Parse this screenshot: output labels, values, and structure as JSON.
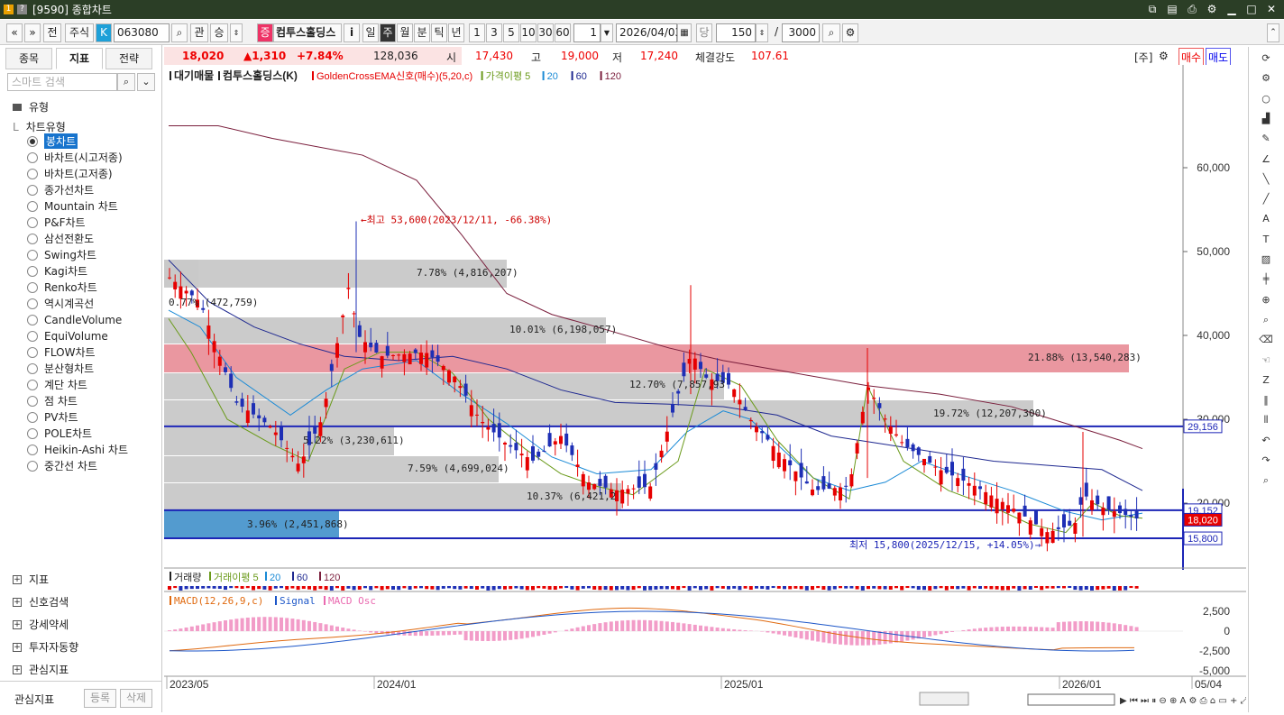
{
  "window": {
    "title": "[9590] 종합차트"
  },
  "toolbar": {
    "market": "주식",
    "code": "063080",
    "name": "컴투스홀딩스",
    "date": "2026/04/03",
    "count": "150",
    "total": "3000",
    "period_buttons": [
      "일",
      "주",
      "월",
      "분",
      "틱",
      "년"
    ],
    "minute_buttons": [
      "1",
      "3",
      "5",
      "10",
      "30",
      "60"
    ],
    "interval_value": "1"
  },
  "left": {
    "tabs": [
      "종목",
      "지표",
      "전략"
    ],
    "search_placeholder": "스마트 검색",
    "section_type": "유형",
    "chart_type_header": "차트유형",
    "chart_types": [
      "봉차트",
      "바차트(시고저종)",
      "바차트(고저종)",
      "종가선차트",
      "Mountain 차트",
      "P&F차트",
      "삼선전환도",
      "Swing차트",
      "Kagi차트",
      "Renko차트",
      "역시계곡선",
      "CandleVolume",
      "EquiVolume",
      "FLOW차트",
      "분산형차트",
      "계단 차트",
      "점 차트",
      "PV차트",
      "POLE차트",
      "Heikin-Ashi 차트",
      "중간선 차트"
    ],
    "bottom_sections": [
      "지표",
      "신호검색",
      "강세약세",
      "투자자동향",
      "관심지표"
    ],
    "footer_label": "관심지표",
    "footer_btn1": "등록",
    "footer_btn2": "삭제"
  },
  "ticker": {
    "price": "18,020",
    "change": "▲1,310",
    "rate": "+7.84%",
    "volume": "128,036",
    "open_label": "시",
    "open": "17,430",
    "high_label": "고",
    "high": "19,000",
    "low_label": "저",
    "low": "17,240",
    "strength_label": "체결강도",
    "strength": "107.61",
    "buy_label": "매수",
    "sell_label": "매도",
    "unit": "[주]"
  },
  "chart_data": {
    "type": "candlestick",
    "legend": [
      "대기매물",
      "컴투스홀딩스(K)",
      "GoldenCrossEMA신호(매수)(5,20,c)",
      "가격이평 5",
      "20",
      "60",
      "120"
    ],
    "y_ticks": [
      "60,000",
      "50,000",
      "40,000",
      "30,000",
      "20,000"
    ],
    "x_ticks": [
      "2023/05",
      "2024/01",
      "2025/01",
      "2026/01",
      "05/04"
    ],
    "price_tags": [
      "29,156",
      "19,152",
      "18,020",
      "15,800"
    ],
    "high_annotation": "최고 53,600(2023/12/11, -66.38%)",
    "low_annotation": "최저 15,800(2025/12/15, +14.05%)",
    "volume_profile": [
      {
        "label": "0.77% (472,759)",
        "value": 0.77
      },
      {
        "label": "7.78% (4,816,207)",
        "value": 7.78
      },
      {
        "label": "10.01% (6,198,057)",
        "value": 10.01
      },
      {
        "label": "21.88% (13,540,283)",
        "value": 21.88
      },
      {
        "label": "12.70% (7,857,93",
        "value": 12.7
      },
      {
        "label": "19.72% (12,207,300)",
        "value": 19.72
      },
      {
        "label": "5.22% (3,230,611)",
        "value": 5.22
      },
      {
        "label": "7.59% (4,699,024)",
        "value": 7.59
      },
      {
        "label": "10.37% (6,421,2",
        "value": 10.37
      },
      {
        "label": "3.96% (2,451,868)",
        "value": 3.96
      }
    ],
    "volume_legend": [
      "거래량",
      "거래이평 5",
      "20",
      "60",
      "120"
    ],
    "macd_legend": [
      "MACD(12,26,9,c)",
      "Signal",
      "MACD Osc"
    ],
    "macd_ticks": [
      "2,500",
      "0",
      "-2,500",
      "-5,000"
    ],
    "colors": {
      "up": "#e60000",
      "down": "#1e2fb5",
      "ma5": "#6a9a1a",
      "ma20": "#1a8ad6",
      "ma60": "#1e2890",
      "ma120": "#7a1e3c",
      "hline": "#1c25b6"
    }
  }
}
